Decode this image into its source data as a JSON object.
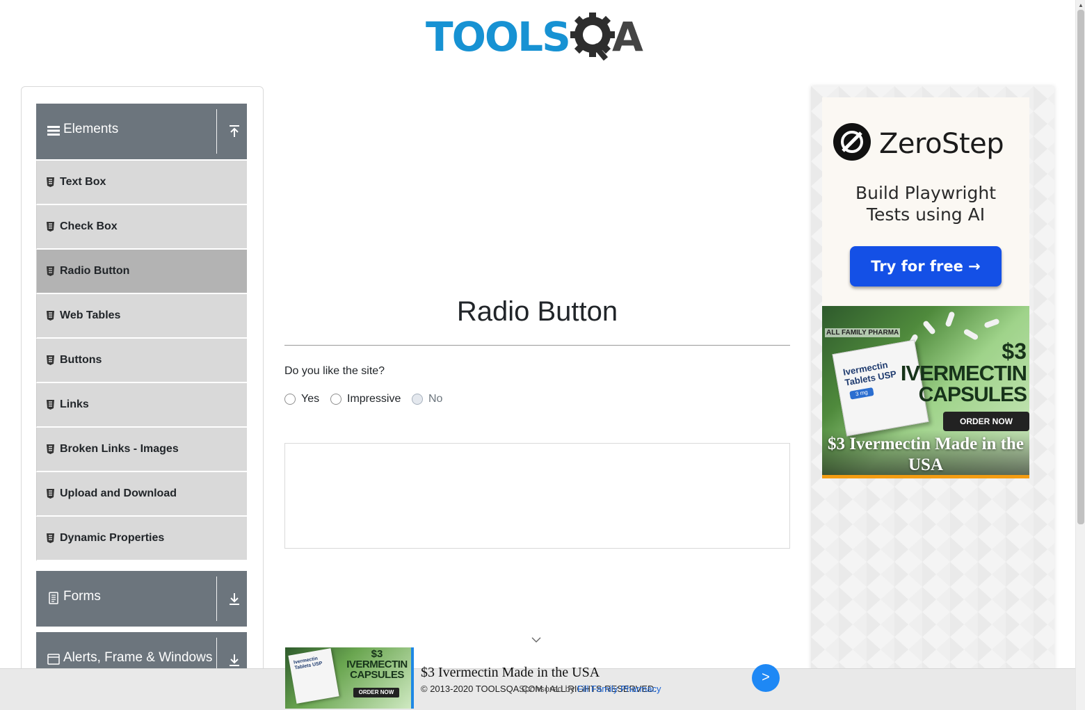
{
  "header": {
    "logo_text": "TOOLS",
    "logo_suffix": "A"
  },
  "sidebar": {
    "groups": [
      {
        "label": "Elements",
        "icon": "hamburger-icon",
        "toggle_icon": "collapse-up-icon"
      },
      {
        "label": "Forms",
        "icon": "document-icon",
        "toggle_icon": "expand-down-icon"
      },
      {
        "label": "Alerts, Frame & Windows",
        "icon": "window-icon",
        "toggle_icon": "expand-down-icon"
      }
    ],
    "items": [
      {
        "label": "Text Box"
      },
      {
        "label": "Check Box"
      },
      {
        "label": "Radio Button",
        "active": true
      },
      {
        "label": "Web Tables"
      },
      {
        "label": "Buttons"
      },
      {
        "label": "Links"
      },
      {
        "label": "Broken Links - Images"
      },
      {
        "label": "Upload and Download"
      },
      {
        "label": "Dynamic Properties"
      }
    ]
  },
  "main": {
    "title": "Radio Button",
    "question": "Do you like the site?",
    "options": [
      {
        "label": "Yes",
        "checked": false,
        "disabled": false
      },
      {
        "label": "Impressive",
        "checked": false,
        "disabled": false
      },
      {
        "label": "No",
        "checked": false,
        "disabled": true
      }
    ]
  },
  "right_ad": {
    "brand": "ZeroStep",
    "tagline_line1": "Build Playwright",
    "tagline_line2": "Tests using AI",
    "cta": "Try for free →",
    "promo_brand": "ALL FAMILY PHARMA",
    "promo_box_line1": "Ivermectin",
    "promo_box_line2": "Tablets USP",
    "promo_box_dose": "3 mg",
    "promo_price": "$3",
    "promo_name": "IVERMECTIN",
    "promo_form": "CAPSULES",
    "promo_cta": "ORDER NOW",
    "promo_caption": "$3 Ivermectin Made in the USA",
    "accent_color": "#1450e6"
  },
  "bottom_ad": {
    "price": "$3",
    "name": "IVERMECTIN",
    "form": "CAPSULES",
    "cta": "ORDER NOW",
    "box_text": "Ivermectin Tablets USP",
    "title": "$3 Ivermectin Made in the USA",
    "next_label": ">"
  },
  "footer": {
    "copyright": "© 2013-2020 TOOLSQA.COM | ALL RIGHTS RESERVED.",
    "sponsored_prefix": "Sponsored by ",
    "sponsored_link": "Fill Family Pharmacy"
  }
}
